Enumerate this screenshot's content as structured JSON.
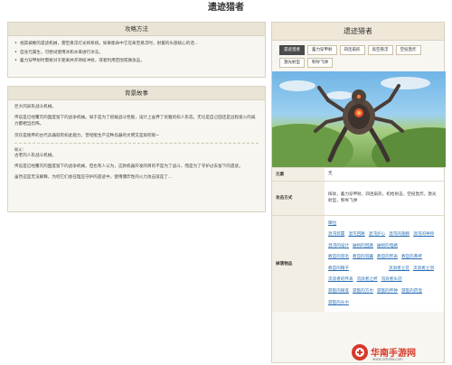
{
  "page": {
    "title": "遗迹猎者"
  },
  "tips": {
    "heading": "攻略方法",
    "items": [
      "视其被摧的遗迹机械，需空悬浮灯光将系统。如果能命中它在离空悬浮时，射着的头部核心的话...",
      "自身元属生，可尝试使用冰和水来进行冰冻。",
      "蓄力穿甲射时需要对于距离并开持续冲射，或者利用范围或微攻击。"
    ]
  },
  "story": {
    "heading": "背景故事",
    "paragraphs": [
      "巨大的异形战斗机械。",
      "传说是已经覆灭的国度留下的战争机械。如于是为了搭载战斗性能，设计上舍弃了优雅的扣人形态。无论是自己固还是远程投火的威力都相当恐怖。",
      "仅仅是搜弃的古代兵器就有如此能力，曾经能生产这种兵器的文明又是如何呢~"
    ],
    "note_label": "释义：",
    "note_text": "古老的人形战斗机械。",
    "paragraphs2": [
      "传说是已经覆灭的国度留下的战争机械，但也有人认为，这款机器开发的目的不是为了战斗，而是为了守护过去留下的遗迹。",
      "虽然这是无法解释，为何它们会在理应守护的遗迹中，使用爆炸性的火力攻击就是了…"
    ]
  },
  "info": {
    "title": "遗迹猎者",
    "tabs": [
      {
        "label": "遗迹猎者",
        "active": true
      },
      {
        "label": "蓄力穿甲射",
        "active": false
      },
      {
        "label": "四连扇形",
        "active": false
      },
      {
        "label": "高空悬浮",
        "active": false
      },
      {
        "label": "空投轰炸",
        "active": false
      },
      {
        "label": "激光射型",
        "active": false
      },
      {
        "label": "制导飞弹",
        "active": false
      }
    ],
    "element_label": "元素",
    "element_value": "无",
    "attack_label": "攻击方式",
    "attack_value": "挥砍，蓄力穿甲射，四连扇形，机枪射击，空投轰炸，激光射型，制导飞弹",
    "drops_label": "掉落物品",
    "drops": [
      "摩拉",
      "混沌装置",
      "混沌回路",
      "混沌炉心",
      "混沌的翅膀",
      "混沌的导师",
      "混沌的设计",
      "破损的回路",
      "破损的电路",
      "教官的羽毛",
      "教官的羽翼",
      "教官的怀表",
      "教官的茶杯",
      "教官的帽子",
      "流浪者之花",
      "流浪者之羽",
      "流浪者的怀表",
      "流浪者之杯",
      "流浪者头冠",
      "游医的银莲",
      "游医的方巾",
      "游医的怀钟",
      "游医的药壶",
      "游医的头巾"
    ]
  },
  "watermark": {
    "name": "华南手游网",
    "url": "www.zshidw.com"
  },
  "colors": {
    "panel_bg": "#f8f6f1",
    "panel_head": "#eae4d6",
    "border": "#d9d2c3",
    "link": "#2a6fb5",
    "active_tab": "#4a4a4a",
    "watermark": "#d63a2a"
  }
}
